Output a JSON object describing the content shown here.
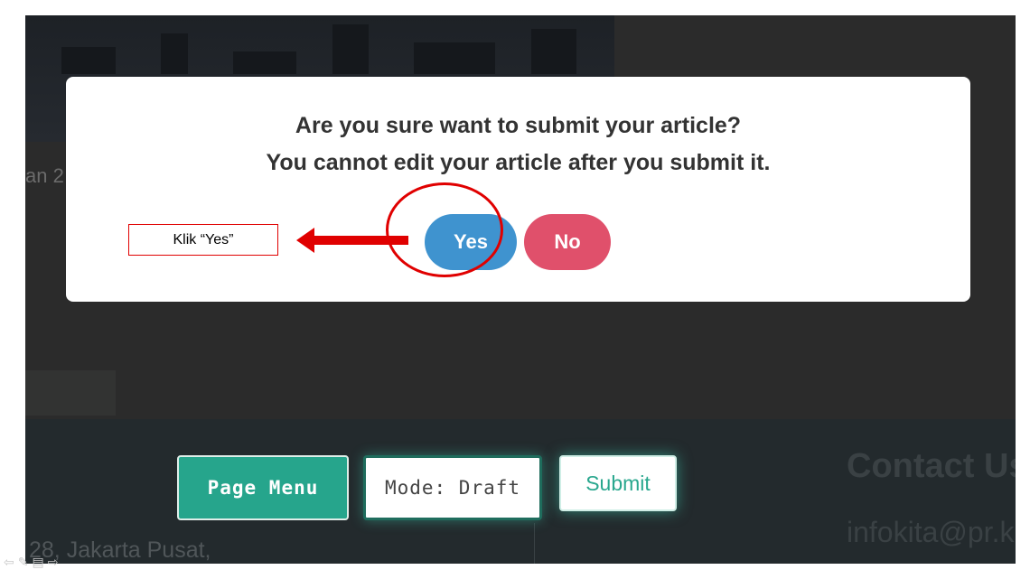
{
  "background": {
    "partial_text": "an 2",
    "footer": {
      "page_menu_label": "Page Menu",
      "mode_label": "Mode: Draft",
      "submit_label": "Submit",
      "contact_title": "Contact Us",
      "contact_email": "infokita@pr.k",
      "address": "28, Jakarta Pusat,"
    }
  },
  "modal": {
    "line1": "Are you sure want to submit your article?",
    "line2": "You cannot edit your article after you submit it.",
    "yes_label": "Yes",
    "no_label": "No"
  },
  "annotation": {
    "callout_text": "Klik “Yes”",
    "color": "#e00000"
  },
  "colors": {
    "yes": "#3f93cf",
    "no": "#e0506b",
    "page_menu": "#26a58c",
    "overlay": "#2b2b2b"
  },
  "slide_nav_icons": [
    "prev-icon",
    "edit-icon",
    "menu-icon",
    "next-icon"
  ]
}
